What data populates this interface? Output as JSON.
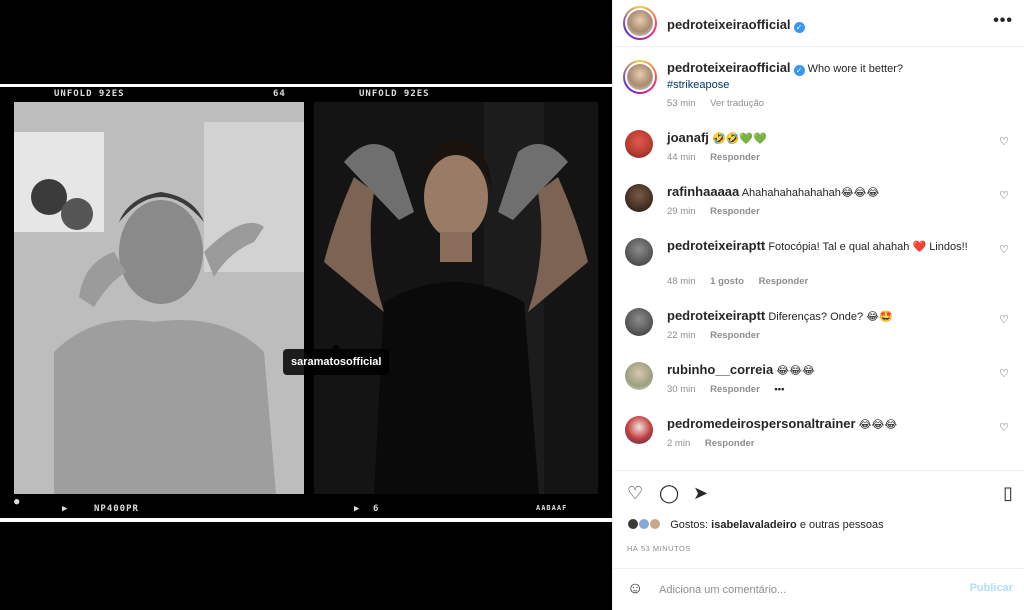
{
  "post": {
    "username": "pedroteixeiraofficial",
    "verified": true,
    "caption_text": "Who wore it better?",
    "hashtag": "#strikeapose",
    "time_ago": "53 min",
    "see_translation": "Ver tradução"
  },
  "media": {
    "film_labels": {
      "left_top": "UNFOLD 92ES",
      "center_top": "64",
      "right_top": "UNFOLD 92ES",
      "left_bottom": "NP400PR",
      "mid_bottom": "6",
      "right_bottom": "AABAAF"
    },
    "tag_username": "saramatosofficial"
  },
  "comments": [
    {
      "username": "joanafj",
      "text": "🤣🤣💚💚",
      "time": "44 min",
      "reply": "Responder",
      "likes": ""
    },
    {
      "username": "rafinhaaaaa",
      "text": "Ahahahahahahahah😂😂😂",
      "time": "29 min",
      "reply": "Responder",
      "likes": ""
    },
    {
      "username": "pedroteixeiraptt",
      "text": "Fotocópia! Tal e qual ahahah ❤️ Lindos!!",
      "time": "48 min",
      "reply": "Responder",
      "likes": "1 gosto"
    },
    {
      "username": "pedroteixeiraptt",
      "text": "Diferenças? Onde? 😂🤩",
      "time": "22 min",
      "reply": "Responder",
      "likes": ""
    },
    {
      "username": "rubinho__correia",
      "text": "😂😂😂",
      "time": "30 min",
      "reply": "Responder",
      "likes": "",
      "more": "•••"
    },
    {
      "username": "pedromedeirospersonaltrainer",
      "text": "😂😂😂",
      "time": "2 min",
      "reply": "Responder",
      "likes": ""
    }
  ],
  "actions": {
    "likes_prefix": "Gostos:",
    "likes_user": "isabelavaladeiro",
    "likes_suffix": "e outras pessoas",
    "posted_ago": "HÁ 53 MINUTOS"
  },
  "composer": {
    "placeholder": "Adiciona um comentário...",
    "post_label": "Publicar"
  },
  "icons": {
    "more": "more-options-icon",
    "like": "heart-icon",
    "comment": "comment-icon",
    "share": "share-icon",
    "save": "bookmark-icon",
    "emoji": "emoji-icon"
  },
  "colors": {
    "verified": "#3897f0",
    "link": "#00376b",
    "muted": "#8e8e8e",
    "publish_disabled": "#b2dffc"
  }
}
